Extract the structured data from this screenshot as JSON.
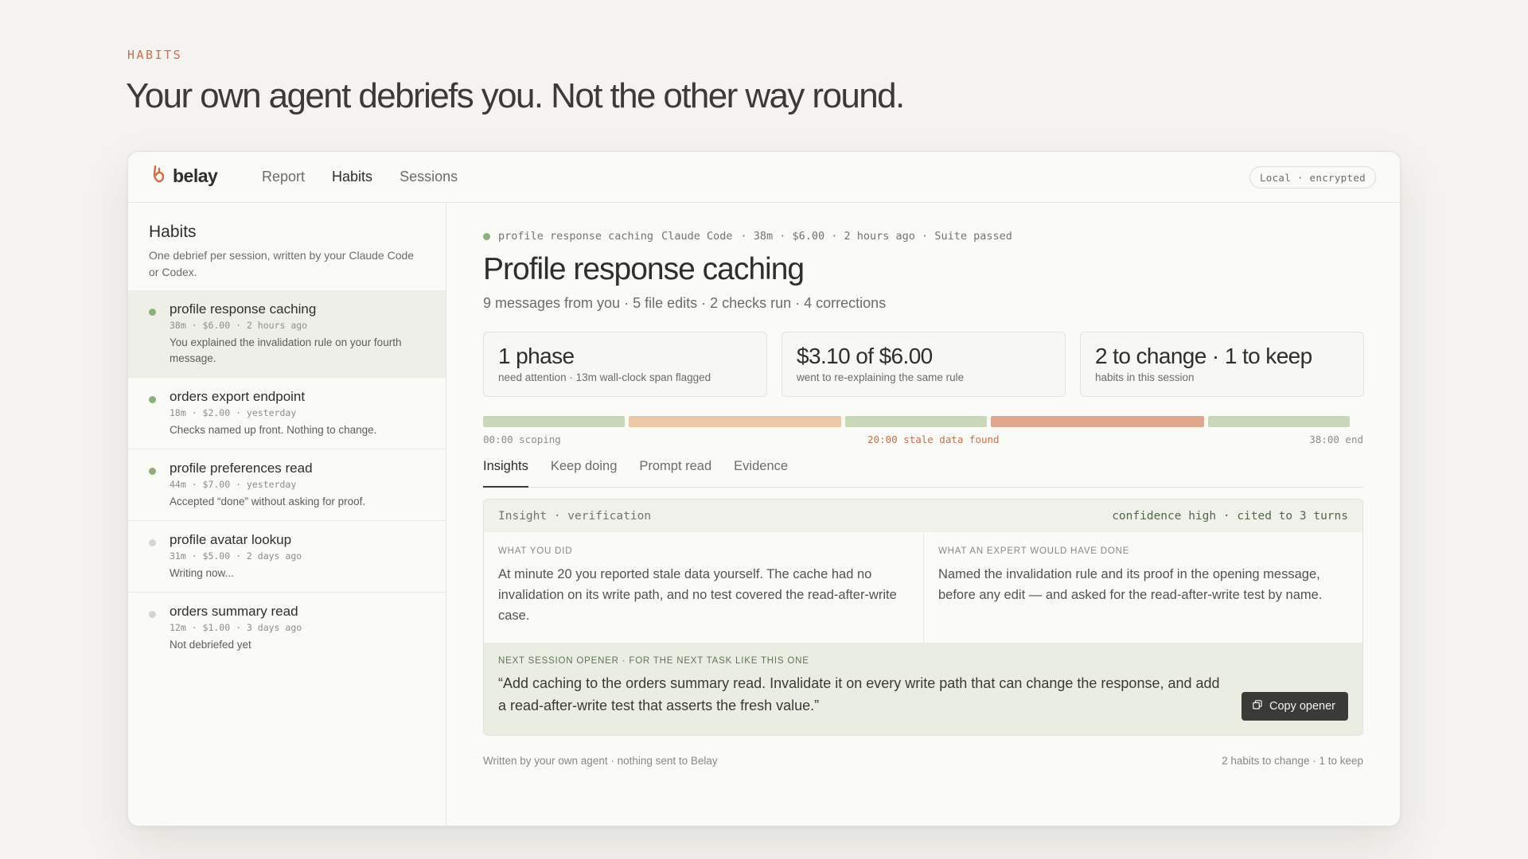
{
  "eyebrow": "HABITS",
  "headline": "Your own agent debriefs you. Not the other way round.",
  "app": {
    "brand": "belay",
    "nav": [
      "Report",
      "Habits",
      "Sessions"
    ],
    "nav_active": "Habits",
    "badge": "Local · encrypted"
  },
  "sidebar": {
    "title": "Habits",
    "description": "One debrief per session, written by your Claude Code or Codex.",
    "items": [
      {
        "name": "profile response caching",
        "meta": "38m · $6.00 · 2 hours ago",
        "note": "You explained the invalidation rule on your fourth message.",
        "status": "done"
      },
      {
        "name": "orders export endpoint",
        "meta": "18m · $2.00 · yesterday",
        "note": "Checks named up front. Nothing to change.",
        "status": "done"
      },
      {
        "name": "profile preferences read",
        "meta": "44m · $7.00 · yesterday",
        "note": "Accepted “done” without asking for proof.",
        "status": "done"
      },
      {
        "name": "profile avatar lookup",
        "meta": "31m · $5.00 · 2 days ago",
        "note": "Writing now...",
        "status": "pending"
      },
      {
        "name": "orders summary read",
        "meta": "12m · $1.00 · 3 days ago",
        "note": "Not debriefed yet",
        "status": "pending"
      }
    ]
  },
  "session": {
    "meta": {
      "name": "profile response caching",
      "agent": "Claude Code",
      "details": "· 38m · $6.00 · 2 hours ago · Suite passed"
    },
    "title": "Profile response caching",
    "subtitle": "9 messages from you · 5 file edits · 2 checks run · 4 corrections",
    "cards": [
      {
        "big": "1 phase",
        "small": "need attention · 13m wall-clock span flagged"
      },
      {
        "big": "$3.10 of $6.00",
        "small": "went to re-explaining the same rule"
      },
      {
        "big": "2 to change · 1 to keep",
        "small": "habits in this session"
      }
    ],
    "timeline": {
      "segments": [
        {
          "share": 0.164,
          "color": "#c9d6b8"
        },
        {
          "share": 0.246,
          "color": "#ecc8a7"
        },
        {
          "share": 0.164,
          "color": "#c9d6b8"
        },
        {
          "share": 0.246,
          "color": "#e1a48c"
        },
        {
          "share": 0.164,
          "color": "#c9d6b8"
        }
      ],
      "label_start": "00:00 scoping",
      "label_mid": "20:00 stale data found",
      "label_end": "38:00 end"
    },
    "tabs": [
      "Insights",
      "Keep doing",
      "Prompt read",
      "Evidence"
    ],
    "tab_active": "Insights",
    "insight": {
      "kind": "Insight · verification",
      "confidence": "confidence high · cited to 3 turns",
      "you_label": "WHAT YOU DID",
      "you_text": "At minute 20 you reported stale data yourself. The cache had no invalidation on its write path, and no test covered the read-after-write case.",
      "expert_label": "WHAT AN EXPERT WOULD HAVE DONE",
      "expert_text": "Named the invalidation rule and its proof in the opening message, before any edit — and asked for the read-after-write test by name.",
      "opener_label": "NEXT SESSION OPENER · FOR THE NEXT TASK LIKE THIS ONE",
      "opener_text": "“Add caching to the orders summary read. Invalidate it on every write path that can change the response, and add a read-after-write test that asserts the fresh value.”",
      "copy_label": "Copy opener"
    },
    "footer_left": "Written by your own agent · nothing sent to Belay",
    "footer_right": "2 habits to change · 1 to keep"
  },
  "colors": {
    "accent": "#c5724f",
    "done_dot": "#8fae7e",
    "pending_dot": "#d7d5cf",
    "flag": "#c5724f"
  }
}
